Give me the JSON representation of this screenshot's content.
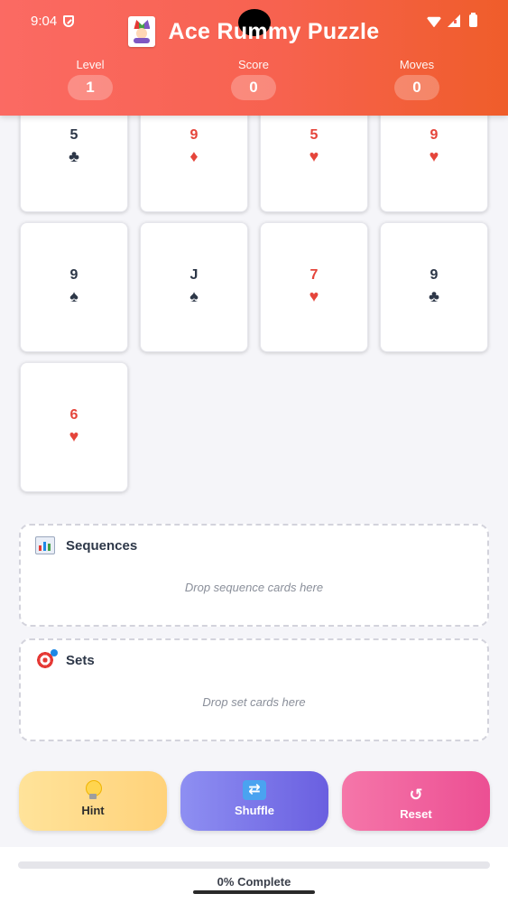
{
  "status": {
    "time": "9:04"
  },
  "header": {
    "title": "Ace Rummy Puzzle",
    "stats": [
      {
        "label": "Level",
        "value": "1"
      },
      {
        "label": "Score",
        "value": "0"
      },
      {
        "label": "Moves",
        "value": "0"
      }
    ]
  },
  "cards": [
    {
      "rank": "5",
      "suit": "♣",
      "color": "black"
    },
    {
      "rank": "9",
      "suit": "♦",
      "color": "red"
    },
    {
      "rank": "5",
      "suit": "♥",
      "color": "red"
    },
    {
      "rank": "9",
      "suit": "♥",
      "color": "red"
    },
    {
      "rank": "9",
      "suit": "♠",
      "color": "black"
    },
    {
      "rank": "J",
      "suit": "♠",
      "color": "black"
    },
    {
      "rank": "7",
      "suit": "♥",
      "color": "red"
    },
    {
      "rank": "9",
      "suit": "♣",
      "color": "black"
    },
    {
      "rank": "6",
      "suit": "♥",
      "color": "red"
    }
  ],
  "zones": {
    "sequences": {
      "title": "Sequences",
      "hint": "Drop sequence cards here",
      "icon": "bar-chart-icon"
    },
    "sets": {
      "title": "Sets",
      "hint": "Drop set cards here",
      "icon": "target-icon"
    }
  },
  "buttons": {
    "hint": {
      "label": "Hint",
      "icon": "lightbulb-icon"
    },
    "shuffle": {
      "label": "Shuffle",
      "icon": "shuffle-icon"
    },
    "reset": {
      "label": "Reset",
      "icon": "↺"
    }
  },
  "progress": {
    "percent": 0,
    "text": "0% Complete"
  },
  "colors": {
    "red": "#e5453b",
    "black": "#2d3748",
    "accent": "#6a5fe0",
    "header": "#f7624f"
  }
}
